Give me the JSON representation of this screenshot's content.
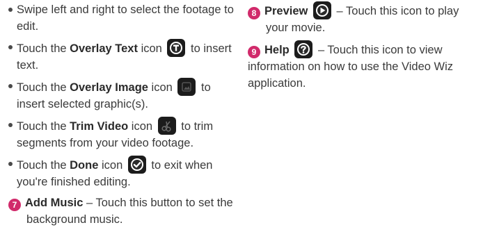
{
  "left_column": {
    "swipe_text": "Swipe left and right to select the footage to edit.",
    "overlay_text": {
      "before": "Touch the ",
      "label": "Overlay Text",
      "mid": " icon",
      "after": " to insert text.",
      "icon": "overlay-text-icon"
    },
    "overlay_image": {
      "before": "Touch the ",
      "label": "Overlay Image",
      "mid": " icon",
      "after": " to insert selected graphic(s).",
      "icon": "overlay-image-icon"
    },
    "trim_video": {
      "before": "Touch the ",
      "label": "Trim Video",
      "mid": " icon",
      "after": " to trim segments from your video footage.",
      "icon": "scissors-icon"
    },
    "done": {
      "before": "Touch the ",
      "label": "Done",
      "mid": " icon",
      "after": " to exit when you're finished editing.",
      "icon": "checkmark-icon"
    },
    "add_music": {
      "number": "7",
      "label": "Add Music",
      "text": " – Touch this button to set the background music."
    }
  },
  "right_column": {
    "preview": {
      "number": "8",
      "label": "Preview",
      "text": " – Touch this icon to play your movie.",
      "icon": "play-icon"
    },
    "help": {
      "number": "9",
      "label": "Help",
      "text": " – Touch this icon to view information on how to use the Video Wiz application.",
      "icon": "help-icon"
    }
  },
  "colors": {
    "number_badge": "#d12a6b",
    "icon_dark": "#1c1c1c",
    "text": "#3a3a3a"
  }
}
